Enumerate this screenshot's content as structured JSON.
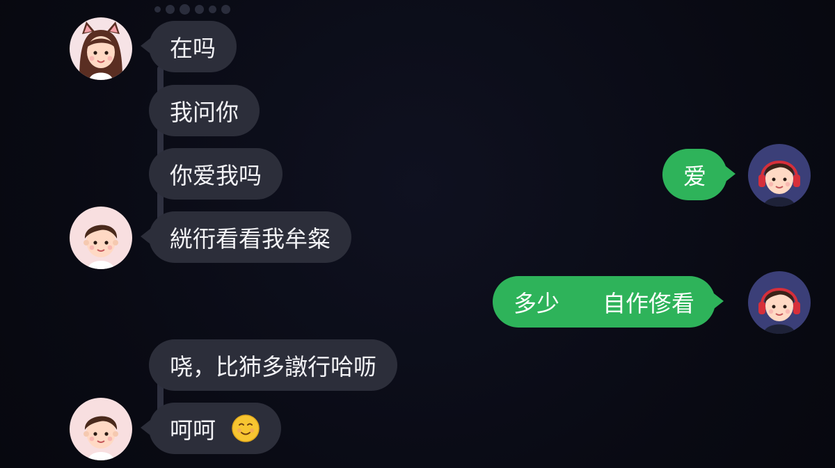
{
  "messages": [
    {
      "id": "m1",
      "side": "incoming",
      "text": "在吗"
    },
    {
      "id": "m2",
      "side": "incoming",
      "text": "我问你"
    },
    {
      "id": "m3",
      "side": "incoming",
      "text": "你爱我吗"
    },
    {
      "id": "m4",
      "side": "outgoing",
      "text": "爱"
    },
    {
      "id": "m5",
      "side": "incoming",
      "text": "絖衎看看我牟粲"
    },
    {
      "id": "m6",
      "side": "outgoing",
      "text_parts": [
        "多少",
        "自作俢看"
      ]
    },
    {
      "id": "m7",
      "side": "incoming",
      "text": "哓，比犻多譈行哈呖"
    },
    {
      "id": "m8",
      "side": "incoming",
      "text": "呵呵",
      "emoji": "smiling-face-emoji"
    }
  ],
  "avatars": {
    "girl": "girl-avatar-cat-ears",
    "boy": "boy-avatar",
    "headphones": "boy-avatar-headphones"
  },
  "colors": {
    "background": "#0a0b14",
    "incoming_bubble": "#2c2e3a",
    "outgoing_bubble": "#2eb35a",
    "text": "#ffffff"
  }
}
